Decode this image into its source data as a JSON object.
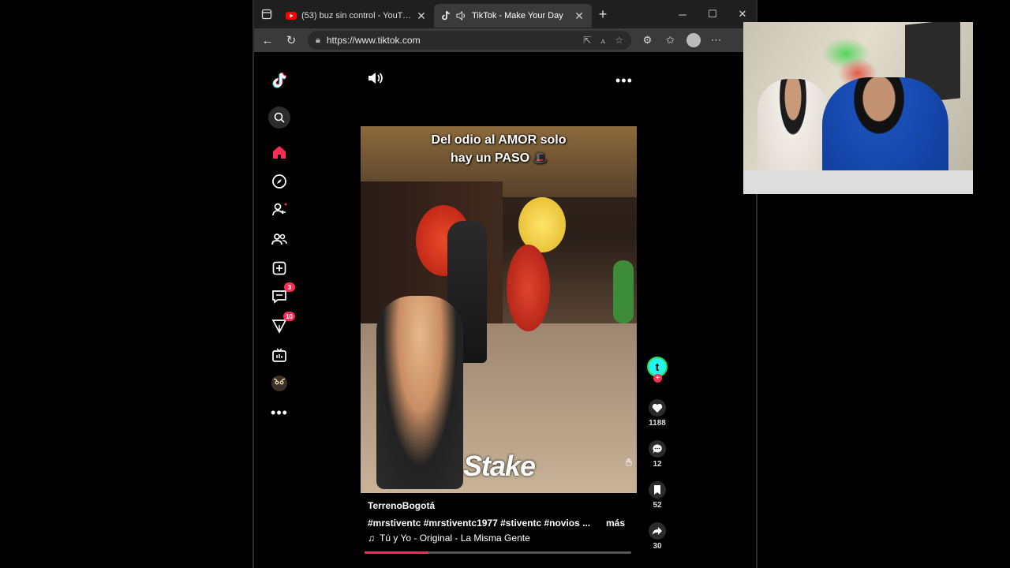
{
  "browser": {
    "tabs": [
      {
        "title": "(53) buz sin control - YouTube",
        "active": false
      },
      {
        "title": "TikTok - Make Your Day",
        "active": true
      }
    ],
    "url": "https://www.tiktok.com"
  },
  "tiktok": {
    "sidebar_badges": {
      "messages": "3",
      "inbox": "10"
    },
    "video": {
      "caption_line1": "Del odio al AMOR solo",
      "caption_line2": "hay un PASO",
      "watermark": "Stake"
    },
    "author": "TerrenoBogotá",
    "hashtags": "#mrstiventc #mrstiventc1977 #stiventc #novios ...",
    "more_label": "más",
    "music": "Tú y Yo - Original - La Misma Gente",
    "progress_fraction": 0.24,
    "counts": {
      "likes": "1188",
      "comments": "12",
      "saves": "52",
      "shares": "30"
    }
  },
  "colors": {
    "accent": "#fe2c55",
    "chrome_dark": "#1f1f1f",
    "chrome_bar": "#3a3a3a"
  },
  "icons": [
    "tiktok-logo-icon",
    "search-icon",
    "home-icon",
    "explore-icon",
    "following-icon",
    "friends-icon",
    "upload-icon",
    "messages-icon",
    "inbox-icon",
    "live-icon",
    "profile-icon",
    "more-icon",
    "volume-icon",
    "heart-icon",
    "comment-icon",
    "bookmark-icon",
    "share-icon"
  ]
}
